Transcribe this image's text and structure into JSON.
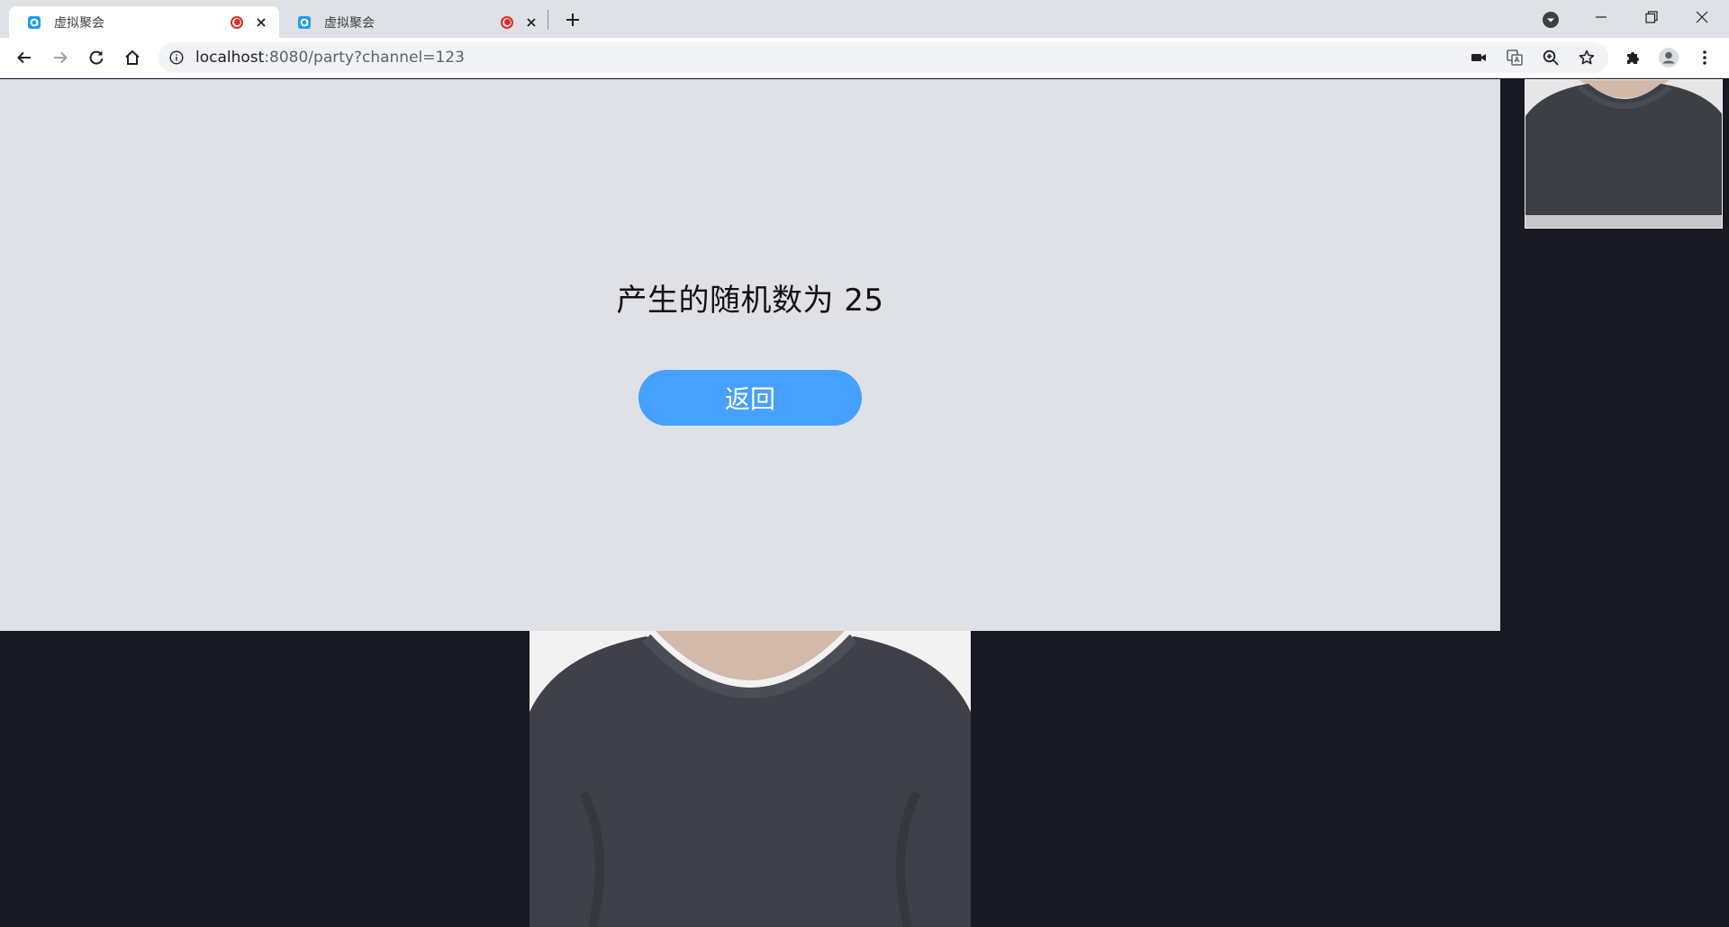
{
  "browser": {
    "tabs": [
      {
        "title": "虚拟聚会",
        "active": true,
        "recording": true
      },
      {
        "title": "虚拟聚会",
        "active": false,
        "recording": true
      }
    ],
    "address": {
      "host": "localhost",
      "rest": ":8080/party?channel=123"
    },
    "icons": {
      "back": "arrow-left-icon",
      "forward": "arrow-right-icon",
      "reload": "reload-icon",
      "home": "home-icon",
      "site_info": "info-icon",
      "camera": "camera-icon",
      "translate": "translate-icon",
      "zoom": "zoom-icon",
      "bookmark": "star-icon",
      "extensions": "puzzle-icon",
      "profile": "profile-icon",
      "menu": "kebab-menu-icon"
    }
  },
  "page": {
    "result_text": "产生的随机数为 25",
    "back_button_label": "返回",
    "colors": {
      "stage_bg": "#dfe1e6",
      "button_bg": "#45a0ff",
      "video_bg": "#181922",
      "recording": "#d93025"
    }
  }
}
